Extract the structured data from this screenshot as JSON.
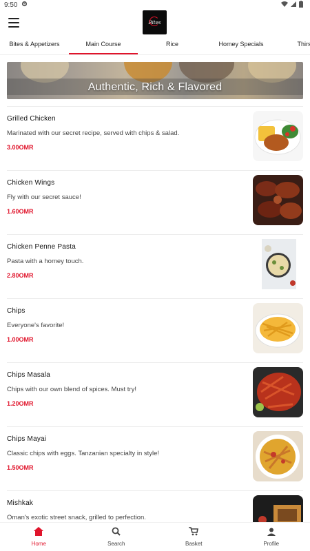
{
  "status_bar": {
    "time": "9:50"
  },
  "app": {
    "logo_text": "Bites"
  },
  "tabs": [
    {
      "label": "Bites & Appetizers"
    },
    {
      "label": "Main Course"
    },
    {
      "label": "Rice"
    },
    {
      "label": "Homey Specials"
    },
    {
      "label": "Thirst Qu"
    }
  ],
  "active_tab": "Main Course",
  "banner": {
    "text": "Authentic, Rich & Flavored"
  },
  "items": [
    {
      "name": "Grilled Chicken",
      "description": "Marinated with our secret recipe, served with chips & salad.",
      "price": "3.00OMR"
    },
    {
      "name": "Chicken Wings",
      "description": "Fly with our secret sauce!",
      "price": "1.60OMR"
    },
    {
      "name": "Chicken Penne Pasta",
      "description": "Pasta with a homey touch.",
      "price": "2.80OMR"
    },
    {
      "name": "Chips",
      "description": "Everyone's favorite!",
      "price": "1.00OMR"
    },
    {
      "name": "Chips Masala",
      "description": "Chips with our own blend of spices. Must try!",
      "price": "1.20OMR"
    },
    {
      "name": "Chips Mayai",
      "description": "Classic chips with eggs. Tanzanian specialty in style!",
      "price": "1.50OMR"
    },
    {
      "name": "Mishkak",
      "description": "Oman's exotic street snack, grilled to perfection.",
      "price": ""
    }
  ],
  "bottom_nav": [
    {
      "label": "Home",
      "icon": "home-icon"
    },
    {
      "label": "Search",
      "icon": "search-icon"
    },
    {
      "label": "Basket",
      "icon": "basket-icon"
    },
    {
      "label": "Profile",
      "icon": "profile-icon"
    }
  ],
  "colors": {
    "accent": "#e0142b",
    "text": "#222222"
  }
}
